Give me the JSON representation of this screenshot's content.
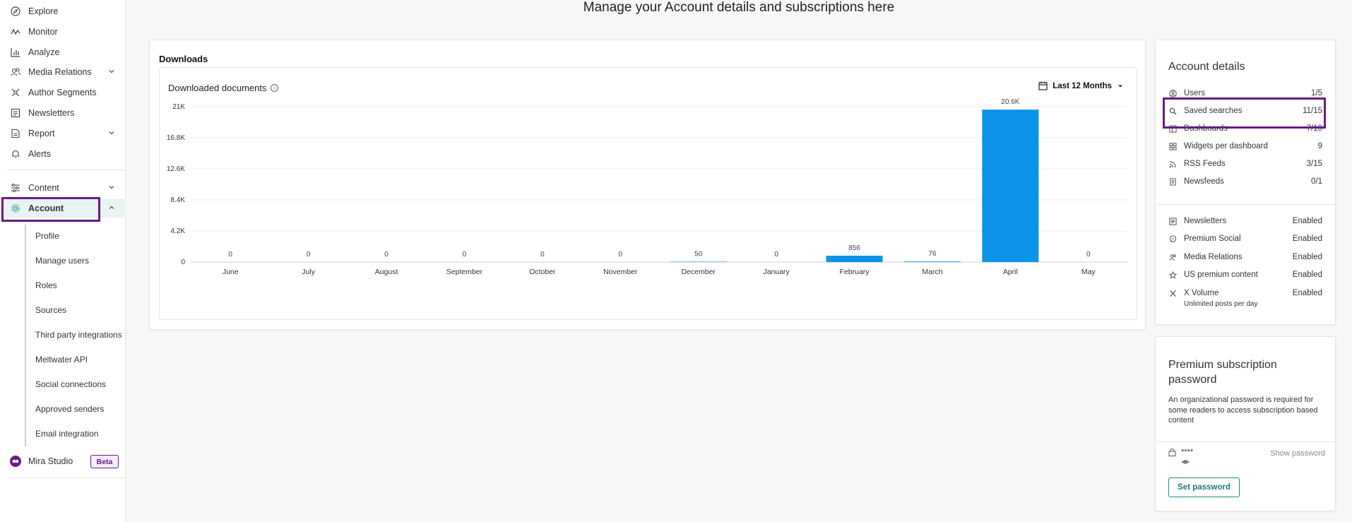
{
  "sidebar": {
    "items": [
      {
        "label": "Explore",
        "icon": "compass-icon"
      },
      {
        "label": "Monitor",
        "icon": "pulse-icon"
      },
      {
        "label": "Analyze",
        "icon": "bar-chart-icon"
      },
      {
        "label": "Media Relations",
        "icon": "people-icon"
      },
      {
        "label": "Author Segments",
        "icon": "network-icon"
      },
      {
        "label": "Newsletters",
        "icon": "newsletter-icon"
      },
      {
        "label": "Report",
        "icon": "report-icon"
      },
      {
        "label": "Alerts",
        "icon": "bell-icon"
      },
      {
        "label": "Content",
        "icon": "sliders-icon"
      },
      {
        "label": "Account",
        "icon": "gear-icon"
      }
    ],
    "account_sub": [
      "Profile",
      "Manage users",
      "Roles",
      "Sources",
      "Third party integrations",
      "Meltwater API",
      "Social connections",
      "Approved senders",
      "Email integration"
    ],
    "mira": {
      "label": "Mira Studio",
      "badge": "Beta"
    }
  },
  "page_title": "Manage your Account details and subscriptions here",
  "downloads": {
    "title": "Downloads",
    "chart_title": "Downloaded documents",
    "range": "Last 12 Months"
  },
  "chart_data": {
    "type": "bar",
    "categories": [
      "June",
      "July",
      "August",
      "September",
      "October",
      "November",
      "December",
      "January",
      "February",
      "March",
      "April",
      "May"
    ],
    "values": [
      0,
      0,
      0,
      0,
      0,
      0,
      50,
      0,
      856,
      76,
      20600,
      0
    ],
    "data_labels": [
      "0",
      "0",
      "0",
      "0",
      "0",
      "0",
      "50",
      "0",
      "856",
      "76",
      "20.6K",
      "0"
    ],
    "yticks": [
      "0",
      "4.2K",
      "8.4K",
      "12.6K",
      "16.8K",
      "21K"
    ],
    "ylim": [
      0,
      21000
    ],
    "bar_color": "#0b93e8"
  },
  "account_details": {
    "title": "Account details",
    "limits": [
      {
        "label": "Users",
        "value": "1/5",
        "icon": "user-circle-icon"
      },
      {
        "label": "Saved searches",
        "value": "11/15",
        "icon": "search-icon"
      },
      {
        "label": "Dashboards",
        "value": "7/10",
        "icon": "dashboard-icon"
      },
      {
        "label": "Widgets per dashboard",
        "value": "9",
        "icon": "widgets-icon"
      },
      {
        "label": "RSS Feeds",
        "value": "3/15",
        "icon": "rss-icon"
      },
      {
        "label": "Newsfeeds",
        "value": "0/1",
        "icon": "newsfeed-icon"
      }
    ],
    "features": [
      {
        "label": "Newsletters",
        "value": "Enabled",
        "icon": "newsletter-icon"
      },
      {
        "label": "Premium Social",
        "value": "Enabled",
        "icon": "chat-icon"
      },
      {
        "label": "Media Relations",
        "value": "Enabled",
        "icon": "people-icon"
      },
      {
        "label": "US premium content",
        "value": "Enabled",
        "icon": "star-icon"
      },
      {
        "label": "X Volume",
        "value": "Enabled",
        "icon": "x-logo-icon"
      }
    ],
    "x_volume_note": "Unlimited posts per day"
  },
  "premium_password": {
    "title": "Premium subscription password",
    "description": "An organizational password is required for some readers to access subscription based content",
    "masked": "****",
    "show_label": "Show password",
    "set_button": "Set password"
  },
  "colors": {
    "accent": "#1b8a8a",
    "highlight": "#6b1a86",
    "bar": "#0b93e8"
  }
}
